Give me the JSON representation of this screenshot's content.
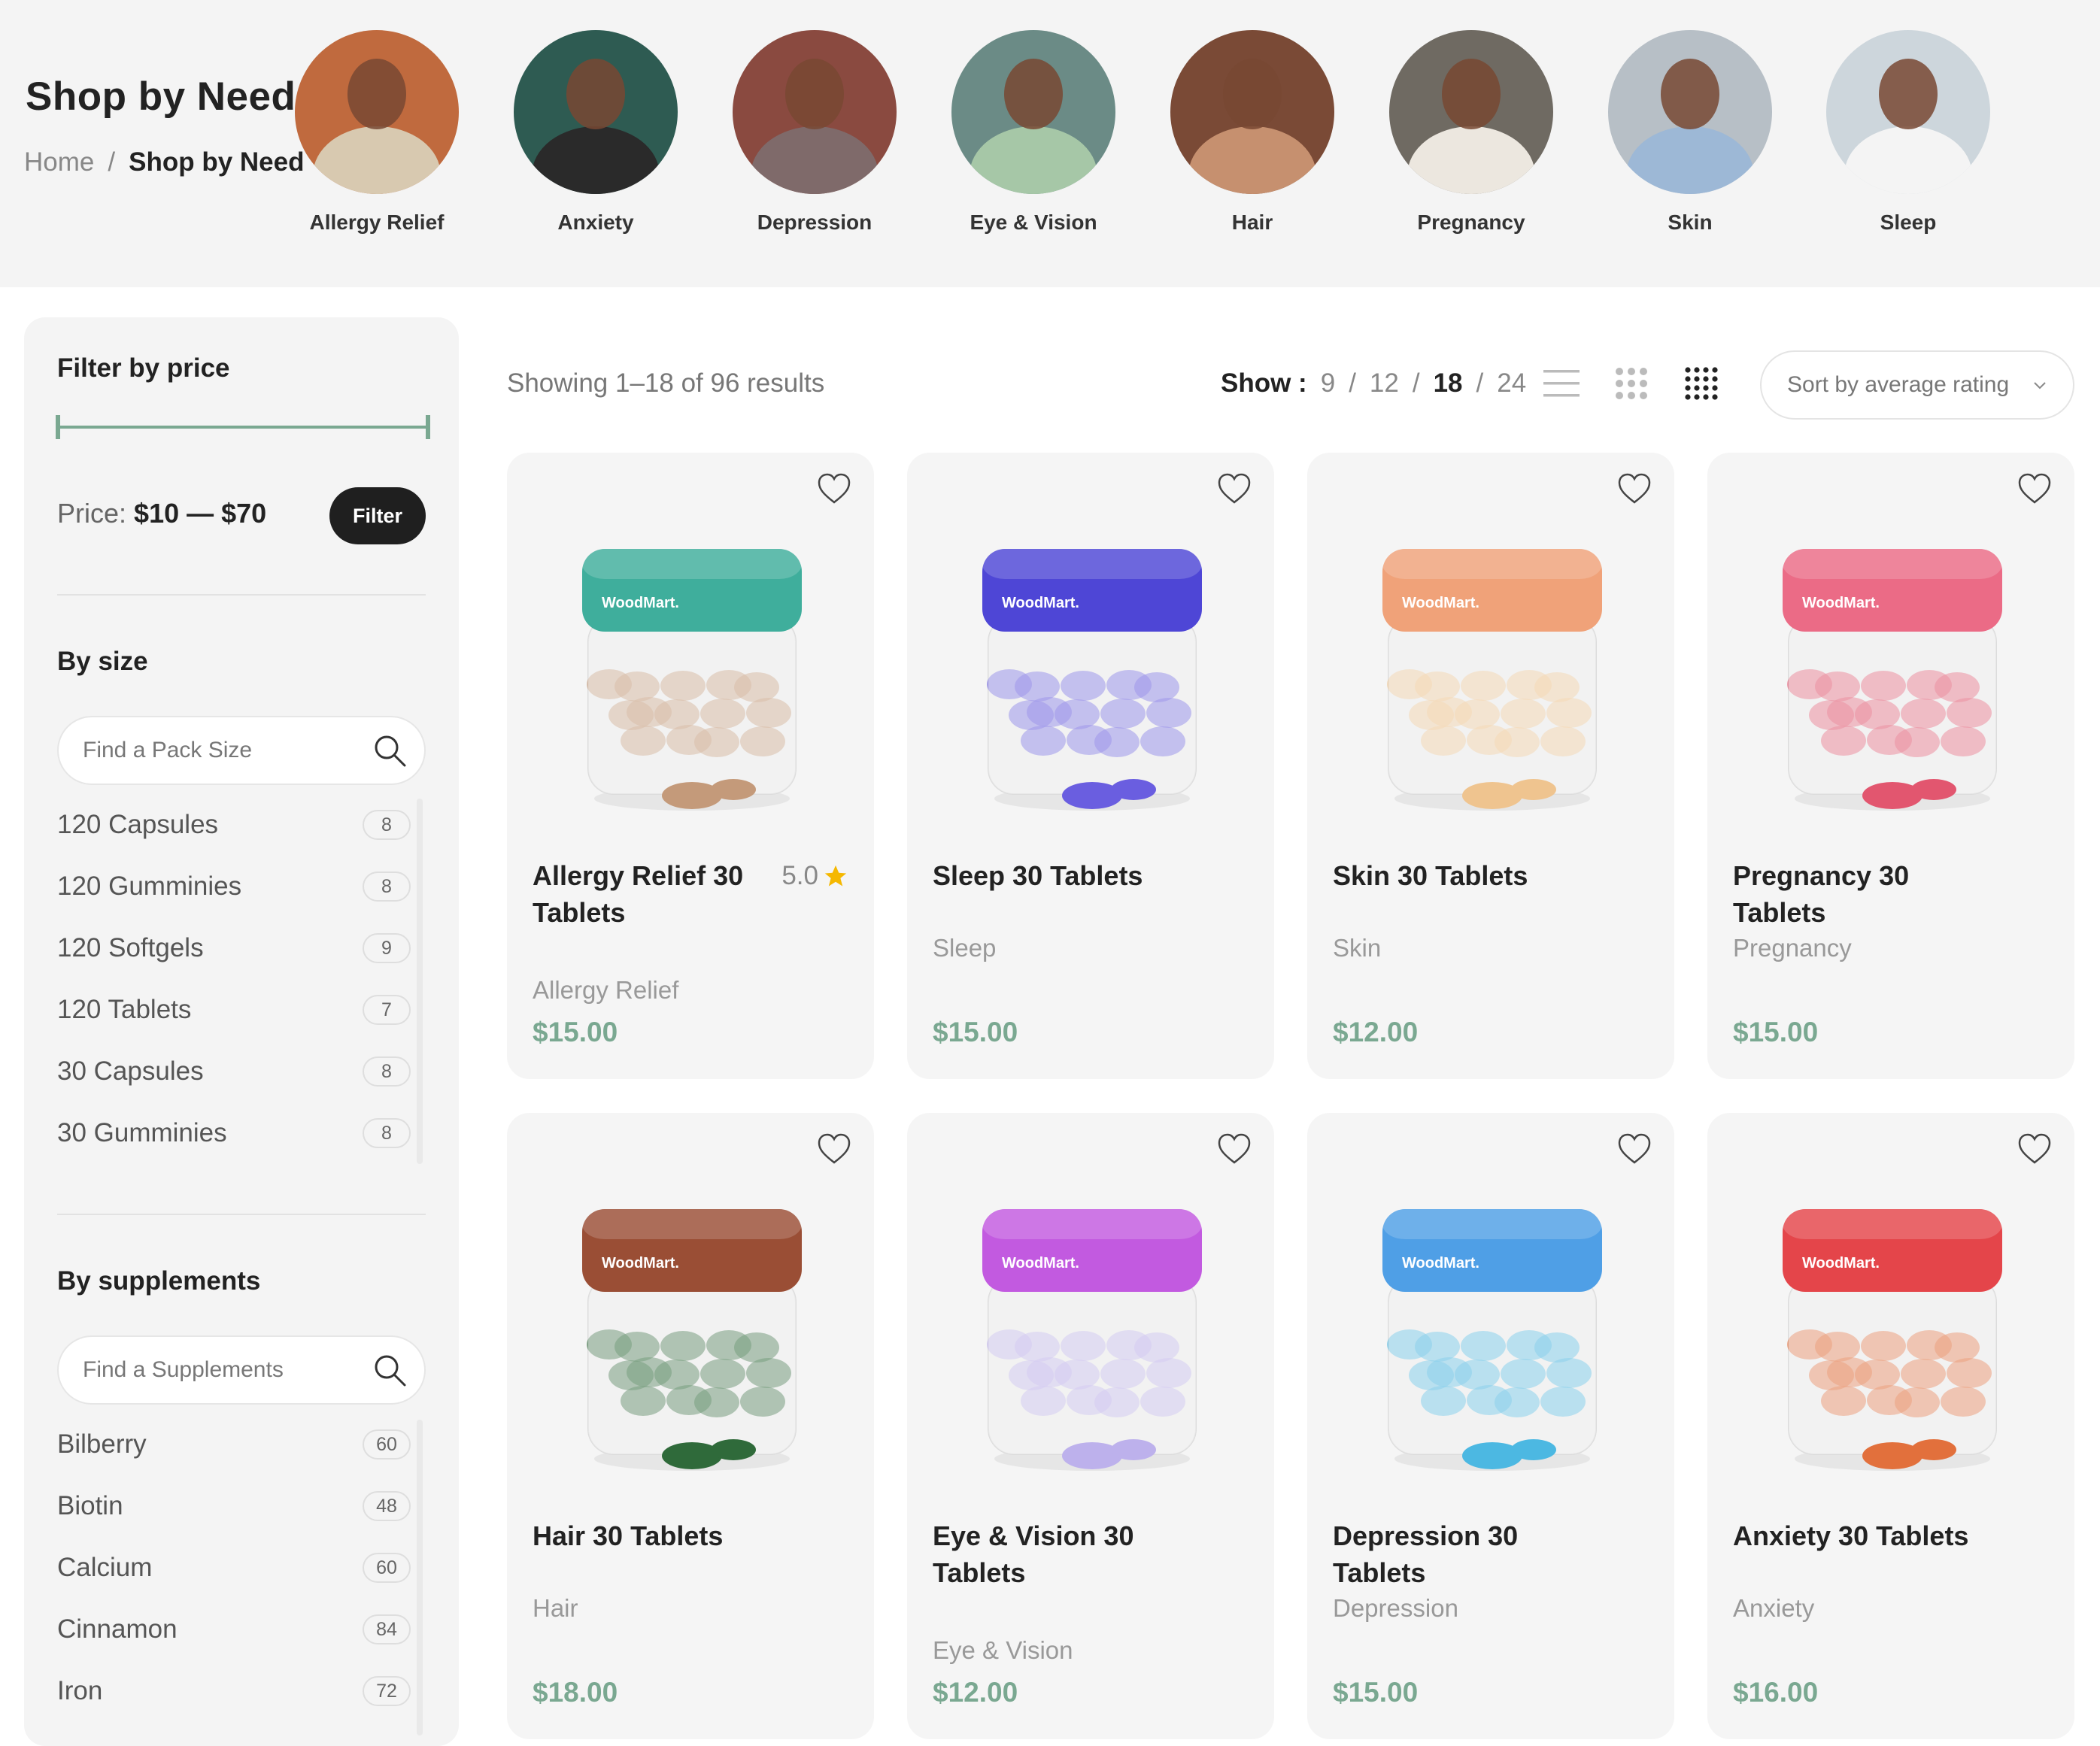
{
  "header": {
    "title": "Shop by Need",
    "breadcrumb": {
      "home": "Home",
      "separator": "/",
      "current": "Shop by Need"
    }
  },
  "needs": [
    {
      "label": "Allergy Relief",
      "bg": "#c06a3e",
      "body": "#d8c9b0"
    },
    {
      "label": "Anxiety",
      "bg": "#2e5b52",
      "body": "#2a2a2a"
    },
    {
      "label": "Depression",
      "bg": "#8a4a40",
      "body": "#7f6a6a"
    },
    {
      "label": "Eye & Vision",
      "bg": "#6b8b86",
      "body": "#a6c7a7"
    },
    {
      "label": "Hair",
      "bg": "#7a4a36",
      "body": "#c6906f"
    },
    {
      "label": "Pregnancy",
      "bg": "#6f6a62",
      "body": "#ece7df"
    },
    {
      "label": "Skin",
      "bg": "#b7bfc6",
      "body": "#9db8d6"
    },
    {
      "label": "Sleep",
      "bg": "#cdd6dc",
      "body": "#f4f4f4"
    }
  ],
  "sidebar": {
    "price": {
      "title": "Filter by price",
      "label": "Price:",
      "value": "$10 — $70",
      "button": "Filter"
    },
    "size": {
      "title": "By size",
      "placeholder": "Find a Pack Size",
      "items": [
        {
          "name": "120 Capsules",
          "count": "8"
        },
        {
          "name": "120 Gumminies",
          "count": "8"
        },
        {
          "name": "120 Softgels",
          "count": "9"
        },
        {
          "name": "120 Tablets",
          "count": "7"
        },
        {
          "name": "30 Capsules",
          "count": "8"
        },
        {
          "name": "30 Gumminies",
          "count": "8"
        }
      ]
    },
    "supplements": {
      "title": "By supplements",
      "placeholder": "Find a Supplements",
      "items": [
        {
          "name": "Bilberry",
          "count": "60"
        },
        {
          "name": "Biotin",
          "count": "48"
        },
        {
          "name": "Calcium",
          "count": "60"
        },
        {
          "name": "Cinnamon",
          "count": "84"
        },
        {
          "name": "Iron",
          "count": "72"
        }
      ]
    }
  },
  "toolbar": {
    "showing": "Showing 1–18 of 96 results",
    "show_label": "Show :",
    "show_options": [
      "9",
      "12",
      "18",
      "24"
    ],
    "show_active": "18",
    "show_separator": "/",
    "sort": "Sort by average rating"
  },
  "products": [
    {
      "name": "Allergy Relief 30 Tablets",
      "category": "Allergy Relief",
      "price": "$15.00",
      "rating": "5.0",
      "lid": "#3fae9c",
      "pill": "#c49a7a",
      "brand": "WoodMart."
    },
    {
      "name": "Sleep 30 Tablets",
      "category": "Sleep",
      "price": "$15.00",
      "rating": "",
      "lid": "#4e46d6",
      "pill": "#6a5ee0",
      "brand": "WoodMart."
    },
    {
      "name": "Skin 30 Tablets",
      "category": "Skin",
      "price": "$12.00",
      "rating": "",
      "lid": "#f0a279",
      "pill": "#efc48f",
      "brand": "WoodMart."
    },
    {
      "name": "Pregnancy 30 Tablets",
      "category": "Pregnancy",
      "price": "$15.00",
      "rating": "",
      "lid": "#eb6b86",
      "pill": "#e2566f",
      "brand": "WoodMart."
    },
    {
      "name": "Hair 30 Tablets",
      "category": "Hair",
      "price": "$18.00",
      "rating": "",
      "lid": "#9a4e35",
      "pill": "#2f6a3a",
      "brand": "WoodMart."
    },
    {
      "name": "Eye & Vision 30 Tablets",
      "category": "Eye & Vision",
      "price": "$12.00",
      "rating": "",
      "lid": "#c25ae0",
      "pill": "#bdb1ec",
      "brand": "WoodMart."
    },
    {
      "name": "Depression 30 Tablets",
      "category": "Depression",
      "price": "$15.00",
      "rating": "",
      "lid": "#4f9fe6",
      "pill": "#4cb8e2",
      "brand": "WoodMart."
    },
    {
      "name": "Anxiety 30 Tablets",
      "category": "Anxiety",
      "price": "$16.00",
      "rating": "",
      "lid": "#e4454a",
      "pill": "#e2703c",
      "brand": "WoodMart."
    }
  ],
  "colors": {
    "accent": "#7aa891",
    "star": "#f5b800"
  }
}
